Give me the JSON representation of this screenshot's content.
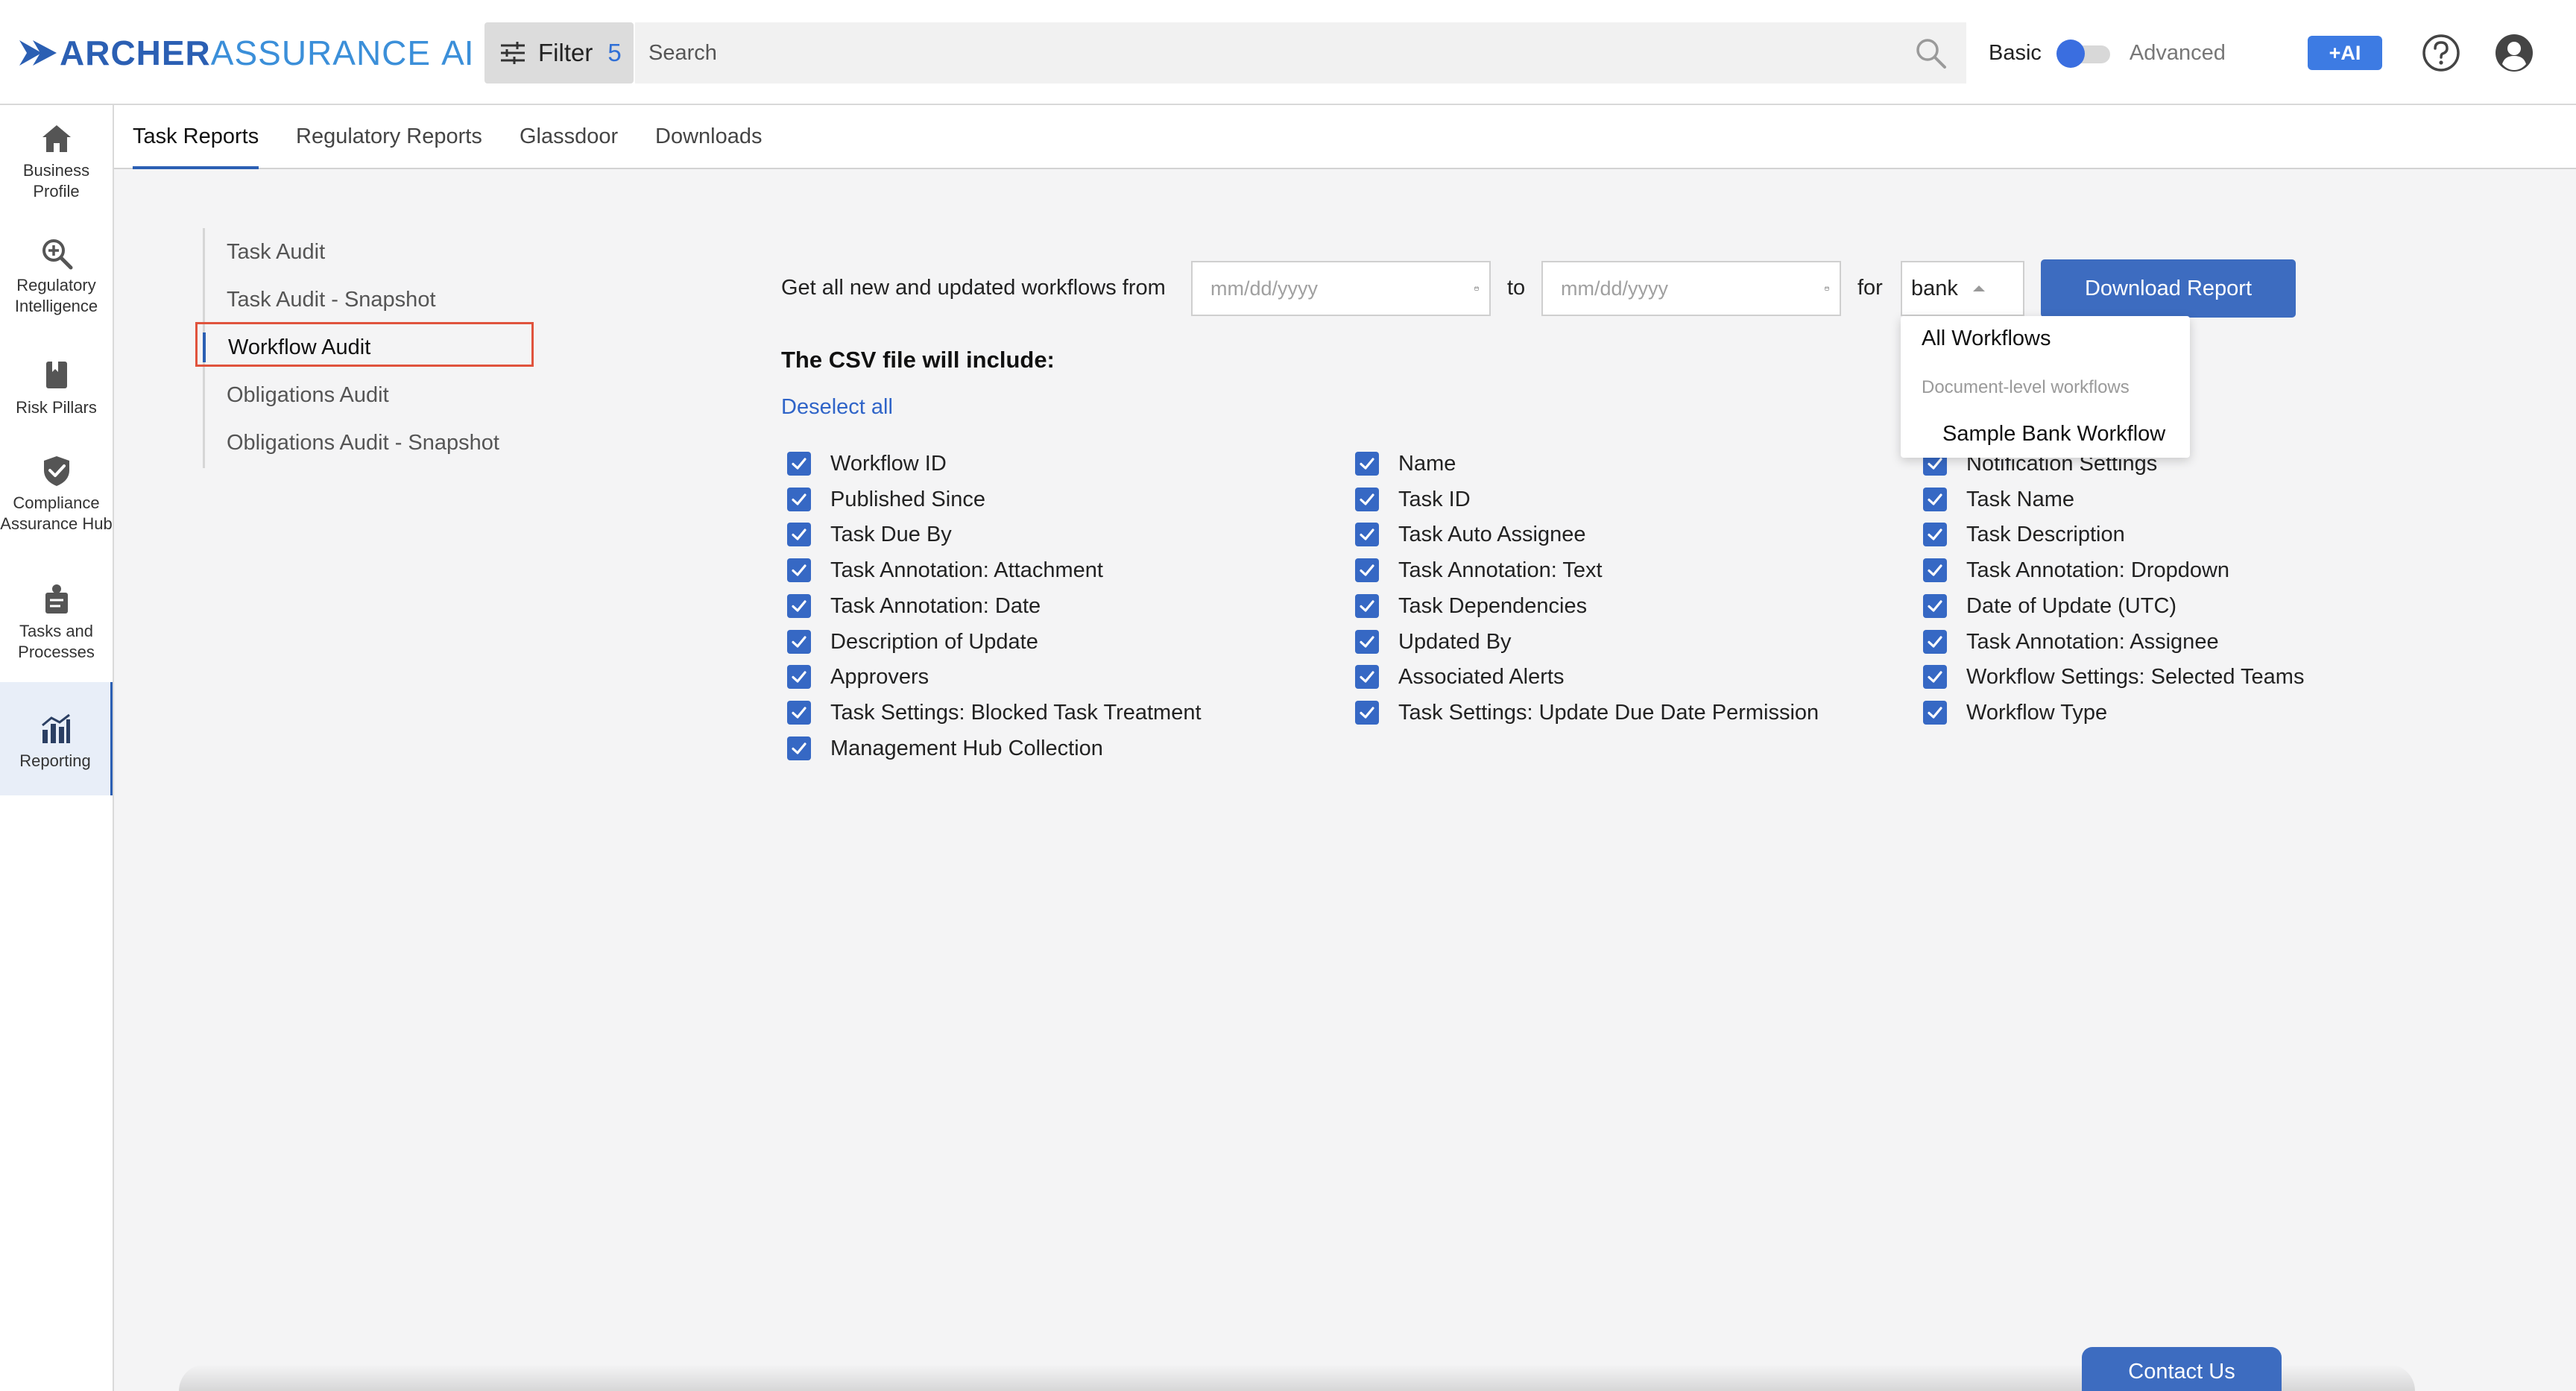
{
  "app": {
    "logo_bold": "ARCHER",
    "logo_light": "ASSURANCE",
    "logo_ai": "AI"
  },
  "topbar": {
    "filter_label": "Filter",
    "filter_count": "5",
    "search_placeholder": "Search",
    "mode_basic": "Basic",
    "mode_advanced": "Advanced",
    "mode_selected": "Basic",
    "ai_button": "+AI"
  },
  "rail": {
    "items": [
      {
        "label": "Business Profile",
        "icon": "home-icon"
      },
      {
        "label": "Regulatory Intelligence",
        "icon": "search-plus-icon"
      },
      {
        "label": "Risk Pillars",
        "icon": "book-icon"
      },
      {
        "label": "Compliance Assurance Hub",
        "icon": "shield-check-icon"
      },
      {
        "label": "Tasks and Processes",
        "icon": "tasks-icon"
      },
      {
        "label": "Reporting",
        "icon": "chart-icon",
        "active": true
      }
    ]
  },
  "tabs": [
    "Task Reports",
    "Regulatory Reports",
    "Glassdoor",
    "Downloads"
  ],
  "subnav": [
    "Task Audit",
    "Task Audit - Snapshot",
    "Workflow Audit",
    "Obligations Audit",
    "Obligations Audit - Snapshot"
  ],
  "form": {
    "prompt": "Get all new and updated workflows from",
    "date_from_placeholder": "mm/dd/yyyy",
    "to_label": "to",
    "date_to_placeholder": "mm/dd/yyyy",
    "for_label": "for",
    "selected_workflow": "bank",
    "download_button": "Download Report",
    "csv_title": "The CSV file will include:",
    "deselect_all": "Deselect all"
  },
  "columns": {
    "col1": [
      "Workflow ID",
      "Published Since",
      "Task Due By",
      "Task Annotation: Attachment",
      "Task Annotation: Date",
      "Description of Update",
      "Approvers",
      "Task Settings: Blocked Task Treatment",
      "Management Hub Collection"
    ],
    "col2": [
      "Name",
      "Task ID",
      "Task Auto Assignee",
      "Task Annotation: Text",
      "Task Dependencies",
      "Updated By",
      "Associated Alerts",
      "Task Settings: Update Due Date Permission"
    ],
    "col3": [
      "Notification Settings",
      "Task Name",
      "Task Description",
      "Task Annotation: Dropdown",
      "Date of Update (UTC)",
      "Task Annotation: Assignee",
      "Workflow Settings: Selected Teams",
      "Workflow Type"
    ]
  },
  "dropdown": {
    "all": "All Workflows",
    "group": "Document-level workflows",
    "option": "Sample Bank Workflow"
  },
  "contact_button": "Contact Us",
  "colors": {
    "brand": "#2b5fb3",
    "accent": "#3d6cc0",
    "highlight": "#e0533d"
  }
}
